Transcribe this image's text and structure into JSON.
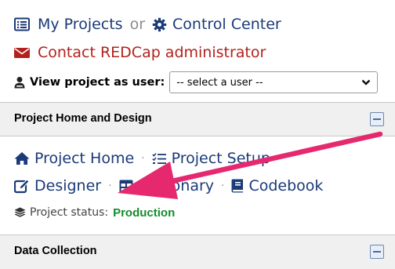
{
  "top": {
    "my_projects": "My Projects",
    "or": "or",
    "control_center": "Control Center",
    "contact": "Contact REDCap administrator",
    "view_as_label": "View project as user:",
    "user_select_value": "-- select a user --"
  },
  "section_design": {
    "title": "Project Home and Design",
    "links": {
      "project_home": "Project Home",
      "project_setup": "Project Setup",
      "designer": "Designer",
      "dictionary": "Dictionary",
      "codebook": "Codebook"
    },
    "status_label": "Project status:",
    "status_value": "Production"
  },
  "section_collection": {
    "title": "Data Collection"
  },
  "colors": {
    "link": "#1a3a78",
    "contact_red": "#b1221d",
    "production_green": "#158c2b",
    "annotation_arrow": "#e6286f"
  }
}
